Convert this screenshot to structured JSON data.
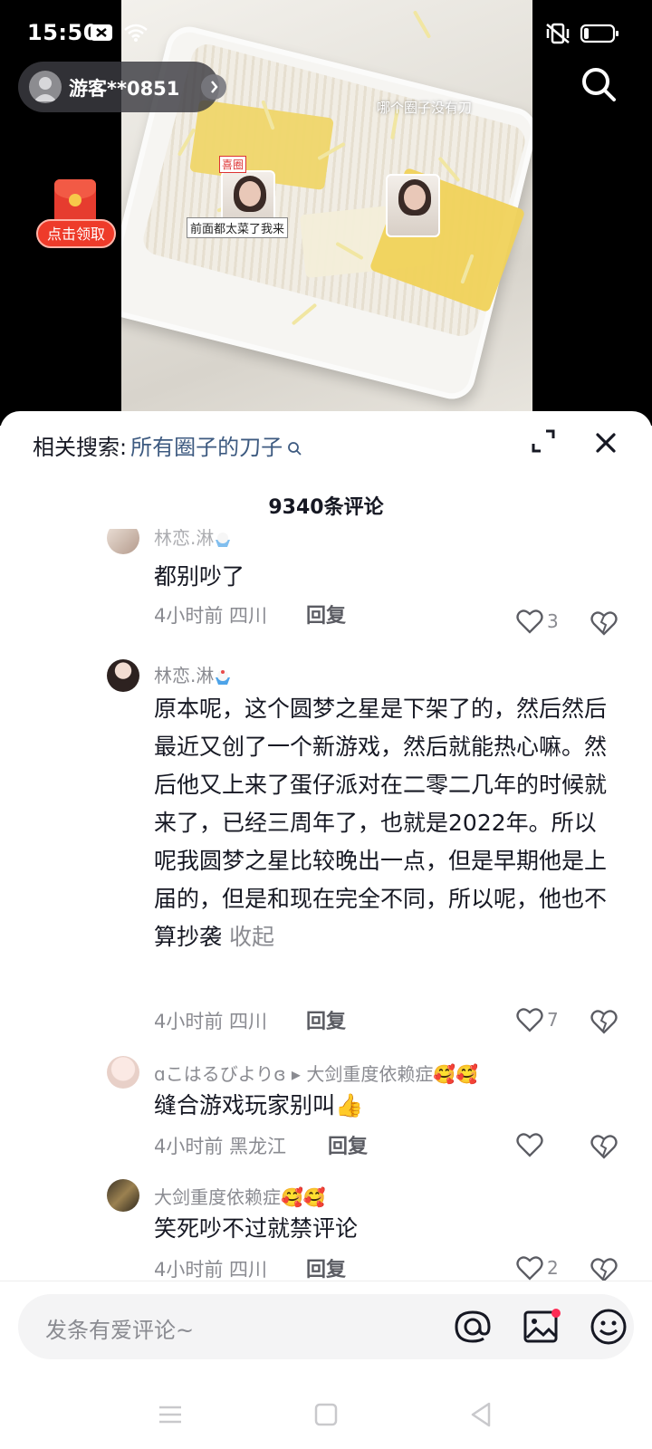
{
  "status_bar": {
    "time": "15:50"
  },
  "video": {
    "caption": "哪个圈子没有刀",
    "sticker_tag": "喜圈",
    "sticker_caption": "前面都太菜了我来"
  },
  "guest": {
    "name": "游客**0851"
  },
  "red_envelope": {
    "label": "点击领取"
  },
  "sheet": {
    "related_label": "相关搜索:",
    "related_query": "所有圈子的刀子",
    "comment_count": "9340条评论"
  },
  "comments": [
    {
      "user": "林恋.淋",
      "text": "都别吵了",
      "time_location": "4小时前 四川",
      "reply_label": "回复",
      "likes": "3"
    },
    {
      "user": "林恋.淋",
      "text": "原本呢，这个圆梦之星是下架了的，然后然后最近又创了一个新游戏，然后就能热心嘛。然后他又上来了蛋仔派对在二零二几年的时候就来了，已经三周年了，也就是2022年。所以呢我圆梦之星比较晚出一点，但是早期他是上届的，但是和现在完全不同，所以呢，他也不算抄袭",
      "collapse_label": "收起",
      "time_location": "4小时前 四川",
      "reply_label": "回复",
      "likes": "7"
    },
    {
      "user": "ɑこはるびよりɞ ▸ 大剑重度依赖症🥰🥰",
      "text": "缝合游戏玩家别叫👍",
      "time_location": "4小时前 黑龙江",
      "reply_label": "回复",
      "likes": ""
    },
    {
      "user": "大剑重度依赖症🥰🥰",
      "text": "笑死吵不过就禁评论",
      "time_location": "4小时前 四川",
      "reply_label": "回复",
      "likes": "2"
    }
  ],
  "input": {
    "placeholder": "发条有爱评论~"
  },
  "colors": {
    "accent_link": "#3d5a80",
    "envelope_red": "#ee3b2a",
    "notification_dot": "#fe2c55"
  }
}
